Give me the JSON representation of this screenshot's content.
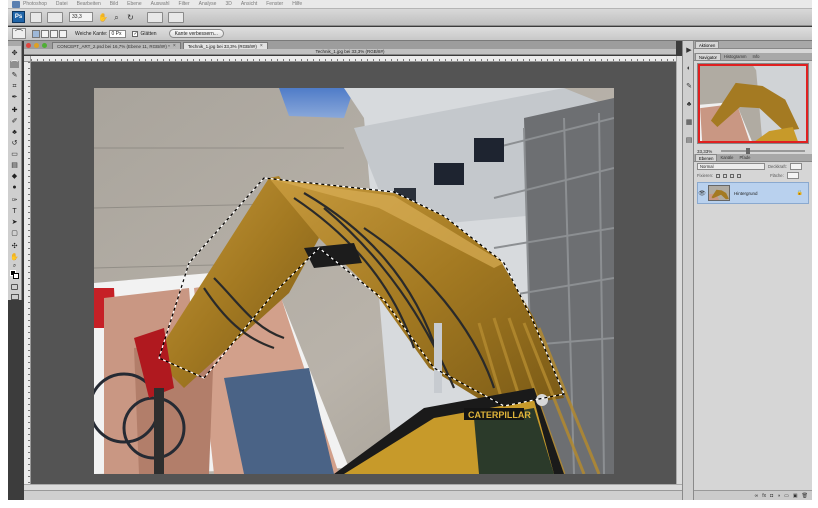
{
  "app": {
    "menus": [
      "Photoshop",
      "Datei",
      "Bearbeiten",
      "Bild",
      "Ebene",
      "Auswahl",
      "Filter",
      "Analyse",
      "3D",
      "Ansicht",
      "Fenster",
      "Hilfe"
    ],
    "badge": "Ps",
    "zoom_value": "33,3"
  },
  "options_bar": {
    "feather_label": "Weiche Kante:",
    "feather_value": "0 Px",
    "antialias_label": "Glätten",
    "refine_button": "Kante verbessern..."
  },
  "document": {
    "tabs": [
      {
        "label": "CONCEPT_ART_2.psd bei 16,7% (Ebene 11, RGB/8#) *",
        "active": false
      },
      {
        "label": "Technik_1.jpg bei 33,3% (RGB/8#)",
        "active": true
      }
    ],
    "title": "Technik_1.jpg bei 33,3% (RGB/8#)",
    "photo_brand": "CATERPILLAR"
  },
  "panels": {
    "top_tab": "Aktionen",
    "nav_tabs": [
      "Navigator",
      "Histogramm",
      "Info"
    ],
    "nav_zoom": "33,33%",
    "layer_tabs": [
      "Ebenen",
      "Kanäle",
      "Pfade"
    ],
    "blend_mode": "Normal",
    "opacity_label": "Deckkraft:",
    "lock_label": "Fixieren:",
    "fill_label": "Fläche:",
    "layer_name": "Hintergrund"
  },
  "icons": {
    "close": "close-icon",
    "eye": "eye-icon",
    "lock": "lock-icon"
  },
  "colors": {
    "app_blue": "#1f64a8",
    "selection_row": "#b9d1ee",
    "nav_frame": "#e02020"
  }
}
